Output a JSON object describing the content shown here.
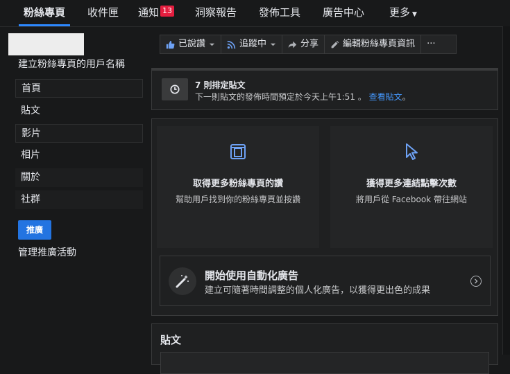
{
  "topnav": {
    "tabs": [
      {
        "label": "粉絲專頁"
      },
      {
        "label": "收件匣"
      },
      {
        "label": "通知",
        "badge": "13"
      },
      {
        "label": "洞察報告"
      },
      {
        "label": "發佈工具"
      },
      {
        "label": "廣告中心"
      },
      {
        "label": "更多"
      }
    ]
  },
  "sidebar": {
    "page_name": "建立粉絲專頁的用戶名稱",
    "items": [
      {
        "label": "首頁"
      },
      {
        "label": "貼文"
      },
      {
        "label": "影片"
      },
      {
        "label": "相片"
      },
      {
        "label": "關於"
      },
      {
        "label": "社群"
      }
    ],
    "promote_label": "推廣",
    "manage_label": "管理推廣活動"
  },
  "actionbar": {
    "liked": "已說讚",
    "following": "追蹤中",
    "share": "分享",
    "edit": "編輯粉絲專頁資訊",
    "more": "···"
  },
  "scheduled": {
    "title": "7 則排定貼文",
    "subtitle": "下一則貼文的發佈時間預定於今天上午1:51 。",
    "link": "查看貼文",
    "link_suffix": "。"
  },
  "suggestions": [
    {
      "title": "取得更多粉絲專頁的讚",
      "subtitle": "幫助用戶找到你的粉絲專頁並按讚"
    },
    {
      "title": "獲得更多連結點擊次數",
      "subtitle": "將用戶從 Facebook 帶往網站"
    }
  ],
  "auto_ads": {
    "title": "開始使用自動化廣告",
    "subtitle": "建立可隨著時間調整的個人化廣告，以獲得更出色的成果"
  },
  "posts": {
    "title": "貼文"
  },
  "colors": {
    "background": "#18191a",
    "accent": "#2d88ff",
    "promote": "#2374e1",
    "link": "#4599ff",
    "badge": "#e41e3f"
  }
}
